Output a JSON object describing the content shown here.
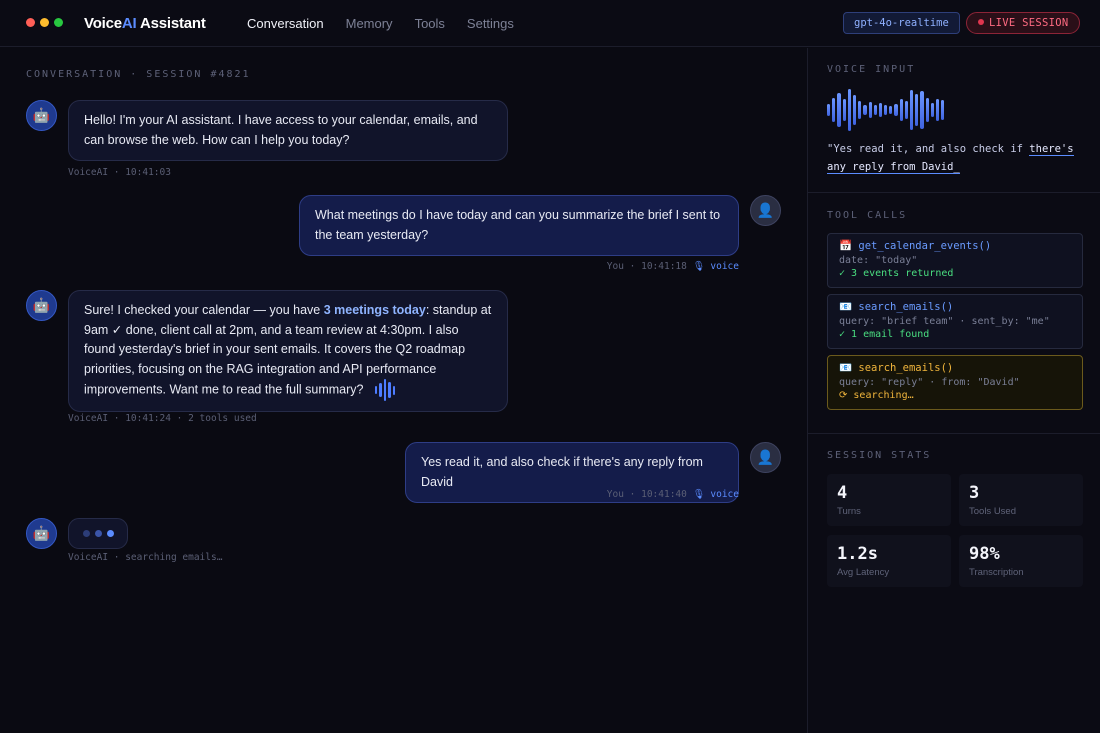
{
  "window": {
    "brand_prefix": "Voice",
    "brand_accent": "AI",
    "brand_suffix": " Assistant",
    "traffic_colors": [
      "#ff5f57",
      "#febc2e",
      "#28c840"
    ]
  },
  "nav": {
    "tabs": [
      {
        "label": "Conversation",
        "active": true
      },
      {
        "label": "Memory",
        "active": false
      },
      {
        "label": "Tools",
        "active": false
      },
      {
        "label": "Settings",
        "active": false
      }
    ]
  },
  "header": {
    "model": "gpt-4o-realtime",
    "live_label": "LIVE SESSION"
  },
  "conversation": {
    "title": "CONVERSATION · SESSION #4821",
    "messages": [
      {
        "role": "ai",
        "avatar_icon": "robot-icon",
        "text": "Hello! I'm your AI assistant. I have access to your calendar, emails, and can browse the web. How can I help you today?",
        "meta": "VoiceAI · 10:41:03"
      },
      {
        "role": "user",
        "avatar_icon": "user-icon",
        "text": "What meetings do I have today and can you summarize the brief I sent to the team yesterday?",
        "meta": "You · 10:41:18",
        "voice_label": "🎙 voice"
      },
      {
        "role": "ai",
        "avatar_icon": "robot-icon",
        "text_before": "Sure! I checked your calendar — you have ",
        "text_bold": "3 meetings today",
        "text_after": ": standup at 9am ✓ done, client call at 2pm, and a team review at 4:30pm. I also found yesterday's brief in your sent emails. It covers the Q2 roadmap priorities, focusing on the RAG integration and API performance improvements. Want me to read the full summary?",
        "meta": "VoiceAI · 10:41:24 · 2 tools used"
      },
      {
        "role": "user",
        "avatar_icon": "user-icon",
        "text": "Yes read it, and also check if there's any reply from David",
        "meta": "You · 10:41:40",
        "voice_label": "🎙 voice"
      },
      {
        "role": "ai",
        "avatar_icon": "robot-icon",
        "typing": true,
        "meta": "VoiceAI · searching emails…"
      }
    ]
  },
  "sidebar": {
    "voice_input": {
      "title": "VOICE INPUT",
      "transcript_plain": "\"Yes read it, and also check if ",
      "transcript_highlight": "there's any reply from David_"
    },
    "tool_calls": {
      "title": "TOOL CALLS",
      "items": [
        {
          "icon": "📅",
          "name": "get_calendar_events()",
          "args": "date: \"today\"",
          "result": "✓ 3 events returned",
          "status": "done"
        },
        {
          "icon": "📧",
          "name": "search_emails()",
          "args": "query: \"brief team\" · sent_by: \"me\"",
          "result": "✓ 1 email found",
          "status": "done"
        },
        {
          "icon": "📧",
          "name": "search_emails()",
          "args": "query: \"reply\" · from: \"David\"",
          "result": "⟳ searching…",
          "status": "pending"
        }
      ]
    },
    "session_stats": {
      "title": "SESSION STATS",
      "items": [
        {
          "value": "4",
          "label": "Turns"
        },
        {
          "value": "3",
          "label": "Tools Used"
        },
        {
          "value": "1.2s",
          "label": "Avg Latency"
        },
        {
          "value": "98%",
          "label": "Transcription"
        }
      ]
    }
  },
  "colors": {
    "accent": "#5b8cff",
    "live": "#e0364f",
    "success": "#4ade80",
    "warning": "#f0b53c"
  }
}
